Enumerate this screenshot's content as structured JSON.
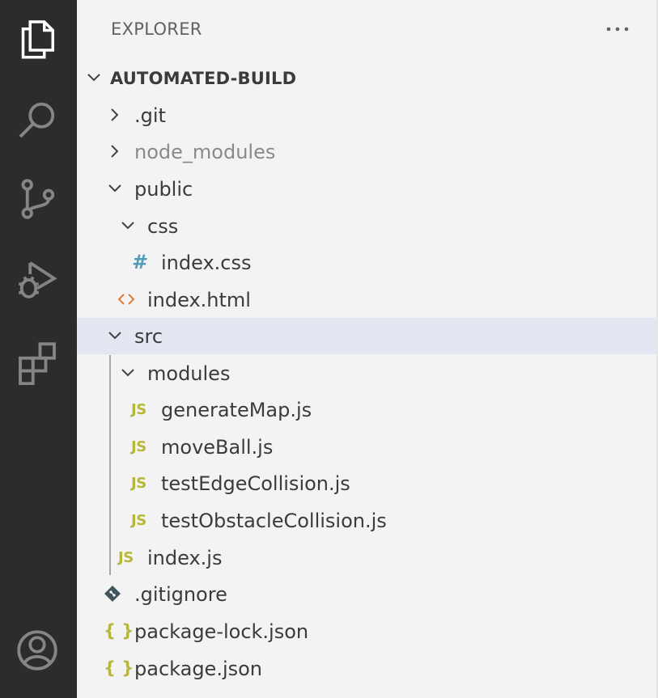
{
  "sidebar": {
    "title": "EXPLORER",
    "root": "AUTOMATED-BUILD"
  },
  "tree": {
    "git": ".git",
    "node_modules": "node_modules",
    "public": "public",
    "css": "css",
    "index_css": "index.css",
    "index_html": "index.html",
    "src": "src",
    "modules": "modules",
    "generateMap": "generateMap.js",
    "moveBall": "moveBall.js",
    "testEdgeCollision": "testEdgeCollision.js",
    "testObstacleCollision": "testObstacleCollision.js",
    "index_js": "index.js",
    "gitignore": ".gitignore",
    "package_lock": "package-lock.json",
    "package": "package.json"
  },
  "icons": {
    "js_glyph": "JS",
    "css_glyph": "#",
    "html_glyph": "<>",
    "json_glyph": "{ }"
  },
  "colors": {
    "activity_bar": "#2c2c2c",
    "sidebar_bg": "#f3f3f3",
    "selected_row": "#e4e6f1",
    "js_icon": "#b7b73b",
    "css_icon": "#519aba",
    "html_icon": "#e37933"
  }
}
